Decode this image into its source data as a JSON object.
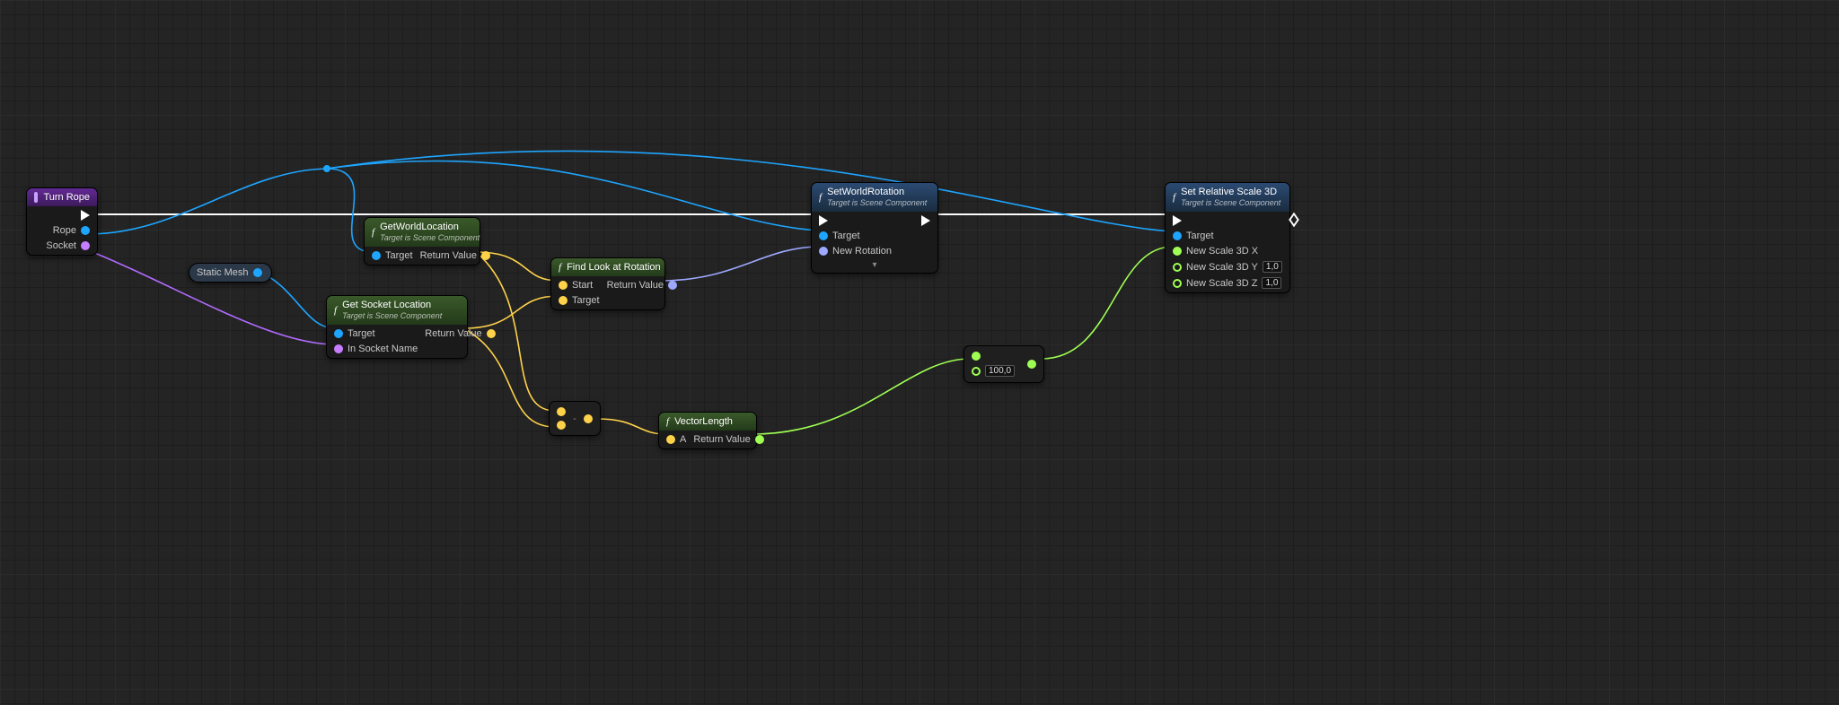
{
  "nodes": {
    "turnRope": {
      "title": "Turn Rope",
      "pins": {
        "rope": "Rope",
        "socket": "Socket"
      }
    },
    "staticMesh": {
      "label": "Static Mesh"
    },
    "getWorldLoc": {
      "title": "GetWorldLocation",
      "sub": "Target is Scene Component",
      "pins": {
        "target": "Target",
        "ret": "Return Value"
      }
    },
    "getSocketLoc": {
      "title": "Get Socket Location",
      "sub": "Target is Scene Component",
      "pins": {
        "target": "Target",
        "inSocket": "In Socket Name",
        "ret": "Return Value"
      }
    },
    "lookAt": {
      "title": "Find Look at Rotation",
      "pins": {
        "start": "Start",
        "target": "Target",
        "ret": "Return Value"
      }
    },
    "subtract": {
      "label": "-"
    },
    "vecLen": {
      "title": "VectorLength",
      "pins": {
        "a": "A",
        "ret": "Return Value"
      }
    },
    "divide": {
      "label": "÷",
      "value": "100,0"
    },
    "setRot": {
      "title": "SetWorldRotation",
      "sub": "Target is Scene Component",
      "pins": {
        "target": "Target",
        "newRot": "New Rotation"
      }
    },
    "setScale": {
      "title": "Set Relative Scale 3D",
      "sub": "Target is Scene Component",
      "pins": {
        "target": "Target",
        "x": "New Scale 3D X",
        "y": "New Scale 3D Y",
        "z": "New Scale 3D Z"
      },
      "vals": {
        "y": "1,0",
        "z": "1,0"
      }
    }
  }
}
